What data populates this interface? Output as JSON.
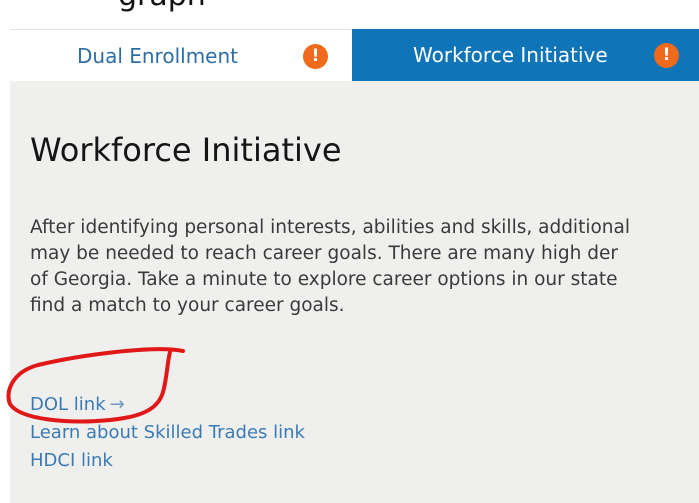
{
  "tabs": [
    {
      "label": "Dual Enrollment",
      "alert_icon": "!",
      "alert_color": "#f06a1c",
      "selected": false
    },
    {
      "label": "Workforce Initiative",
      "alert_icon": "!",
      "alert_color": "#f06a1c",
      "selected": true
    }
  ],
  "colors": {
    "active_tab": "#0f74b8",
    "panel_bg": "#efefed",
    "link": "#3b7bb4",
    "annotation": "#e01818"
  },
  "panel": {
    "title": "Workforce Initiative",
    "paragraph_lines": [
      "After identifying personal interests, abilities and skills, additional",
      "may be needed to reach career goals. There are many high der",
      "of Georgia. Take a minute to explore career options in our state",
      "find a match to your career goals."
    ],
    "links": [
      {
        "label": "DOL link",
        "arrow": "→"
      },
      {
        "label": "Learn about Skilled Trades link"
      },
      {
        "label": "HDCI link"
      }
    ]
  }
}
